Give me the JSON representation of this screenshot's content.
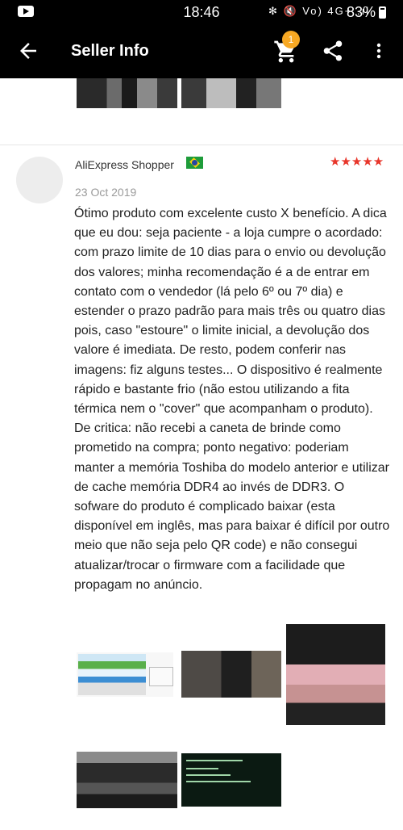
{
  "status_bar": {
    "time": "18:46",
    "icons": "✻ 🔇 Vo) 4G+ .ıl",
    "battery": "83%"
  },
  "app_bar": {
    "title": "Seller Info",
    "cart_count": "1",
    "back_icon": "arrow-left-icon",
    "cart_icon": "cart-icon",
    "share_icon": "share-icon",
    "more_icon": "more-vertical-icon"
  },
  "review": {
    "author": "AliExpress Shopper",
    "country_flag": "brazil-flag",
    "stars": "★★★★★",
    "rating": 5,
    "date": "23 Oct 2019",
    "text": "Ótimo produto com excelente custo X benefício. A dica que eu dou: seja paciente - a loja cumpre o acordado: com prazo limite de 10 dias para o envio ou devolução dos valores; minha recomendação é a de entrar em contato com o vendedor (lá pelo 6º ou 7º dia) e estender o prazo padrão para mais três ou quatro dias pois, caso \"estoure\" o limite inicial, a devolução dos valore é imediata. De resto, podem conferir nas imagens: fiz alguns testes... O dispositivo é realmente rápido e bastante frio (não estou utilizando a fita térmica nem o \"cover\" que acompanham o produto).  De critica: não recebi a caneta de brinde como prometido na compra; ponto negativo: poderiam manter a memória Toshiba do modelo anterior e utilizar de cache memória DDR4 ao invés de DDR3. O sofware do produto é complicado baixar (esta disponível em inglês, mas para baixar é difícil por outro meio que não seja pelo QR code) e não consegui atualizar/trocar o firmware com a facilidade que propagam no anúncio."
  },
  "colors": {
    "appbar": "#000000",
    "badge": "#f7a823",
    "stars": "#e8362b"
  }
}
